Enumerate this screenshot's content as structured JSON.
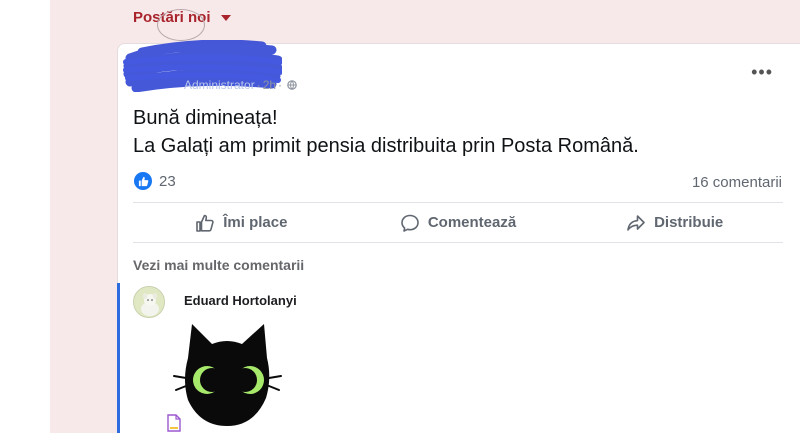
{
  "feed": {
    "header_label": "Postări noi"
  },
  "post": {
    "author_role": "Administrator",
    "time": "2h",
    "line1": "Bună dimineața!",
    "line2": "La Galați am primit pensia distribuita prin Posta Română.",
    "reactions_count": "23",
    "comments_count": "16 comentarii"
  },
  "actions": {
    "like": "Îmi place",
    "comment": "Comentează",
    "share": "Distribuie"
  },
  "comments": {
    "view_more": "Vezi mai multe comentarii",
    "items": [
      {
        "author": "Eduard Hortolanyi",
        "attachment": "black-cat-sticker"
      }
    ]
  },
  "colors": {
    "accent_red": "#a8232b",
    "like_blue": "#1877f2",
    "scribble_blue": "#3b4fd6",
    "thread_blue": "#2d6cdf",
    "cat_eye_green": "#a7e96a"
  },
  "icons": [
    "caret-down-icon",
    "globe-icon",
    "more-options-icon",
    "like-reaction-icon",
    "thumbs-up-icon",
    "comment-icon",
    "share-icon",
    "file-icon"
  ]
}
